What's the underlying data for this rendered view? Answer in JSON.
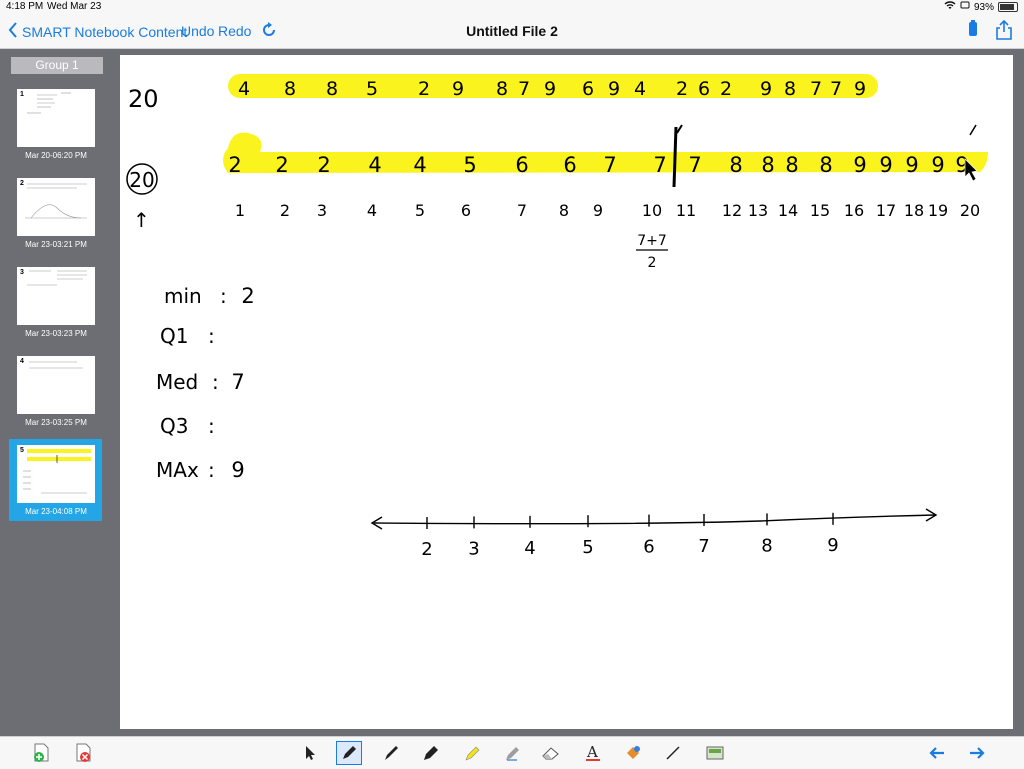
{
  "status_bar": {
    "time": "4:18 PM",
    "date": "Wed Mar 23",
    "battery": "93%"
  },
  "nav": {
    "back_label": "SMART Notebook Content",
    "undo_label": "Undo",
    "redo_label": "Redo",
    "title": "Untitled File 2"
  },
  "sidebar": {
    "group_label": "Group 1",
    "pages": [
      {
        "number": "1",
        "date": "Mar 20-06:20 PM"
      },
      {
        "number": "2",
        "date": "Mar 23-03:21 PM"
      },
      {
        "number": "3",
        "date": "Mar 23-03:23 PM"
      },
      {
        "number": "4",
        "date": "Mar 23-03:25 PM"
      },
      {
        "number": "5",
        "date": "Mar 23-04:08 PM",
        "selected": true
      }
    ]
  },
  "canvas": {
    "row1_count": "20",
    "row1_values": [
      "4",
      "8",
      "8",
      "5",
      "2",
      "9",
      "8",
      "7",
      "9",
      "6",
      "9",
      "4",
      "2",
      "6",
      "2",
      "9",
      "8",
      "7",
      "7",
      "9"
    ],
    "row2_count": "20",
    "row2_values": [
      "2",
      "2",
      "2",
      "4",
      "4",
      "5",
      "6",
      "6",
      "7",
      "7",
      "7",
      "8",
      "8",
      "8",
      "8",
      "9",
      "9",
      "9",
      "9",
      "9"
    ],
    "row2_indices": [
      "1",
      "2",
      "3",
      "4",
      "5",
      "6",
      "7",
      "8",
      "9",
      "10",
      "11",
      "12",
      "13",
      "14",
      "15",
      "16",
      "17",
      "18",
      "19",
      "20"
    ],
    "median_calc_top": "7+7",
    "median_calc_bottom": "2",
    "summary": [
      {
        "label": "min",
        "value": "2"
      },
      {
        "label": "Q1",
        "value": ""
      },
      {
        "label": "Med",
        "value": "7"
      },
      {
        "label": "Q3",
        "value": ""
      },
      {
        "label": "MAx",
        "value": "9"
      }
    ],
    "number_line_ticks": [
      "2",
      "3",
      "4",
      "5",
      "6",
      "7",
      "8",
      "9"
    ]
  },
  "toolbar": {
    "icons": [
      "add-page-icon",
      "delete-page-icon",
      "select-arrow-icon",
      "pen-icon",
      "calligraphy-pen-icon",
      "marker-icon",
      "highlighter-icon",
      "creative-pen-icon",
      "eraser-icon",
      "text-icon",
      "fill-icon",
      "line-icon",
      "shapes-icon",
      "prev-page-icon",
      "next-page-icon"
    ]
  },
  "colors": {
    "accent": "#1a7ce0",
    "highlight": "#fbf31d",
    "sidebar_bg": "#6d6d74",
    "selected_page": "#24a6e6"
  }
}
